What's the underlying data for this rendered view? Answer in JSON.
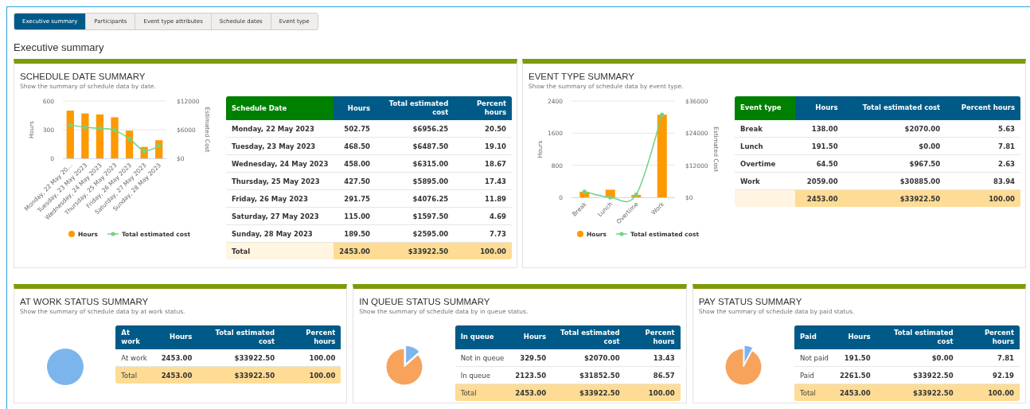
{
  "tabs": [
    {
      "label": "Executive summary",
      "selected": true
    },
    {
      "label": "Participants",
      "selected": false
    },
    {
      "label": "Event type attributes",
      "selected": false
    },
    {
      "label": "Schedule dates",
      "selected": false
    },
    {
      "label": "Event type",
      "selected": false
    }
  ],
  "page_title": "Executive summary",
  "panels": [
    {
      "kind": "combo",
      "title": "SCHEDULE DATE SUMMARY",
      "subtitle": "Show the summary of schedule data by date.",
      "chart_data": {
        "type": "bar",
        "ylabel": "Hours",
        "y2label": "Estimated Cost",
        "categories": [
          "Monday, 22 May 20…",
          "Tuesday, 23 May 2023",
          "Wednesday, 24 May 2023",
          "Thursday, 25 May 2023",
          "Friday, 26 May 2023",
          "Saturday, 27 May 2023",
          "Sunday, 28 May 2023"
        ],
        "series": [
          {
            "name": "Hours",
            "type": "bar",
            "color": "#ff9900",
            "values": [
              500,
              470,
              460,
              430,
              290,
              120,
              190
            ]
          },
          {
            "name": "Total estimated cost",
            "type": "line",
            "axis": "y2",
            "color": "#6fd483",
            "values": [
              7000,
              6500,
              6300,
              5900,
              4100,
              1600,
              2600
            ]
          }
        ],
        "legend": "bottom",
        "ylim": [
          0,
          600
        ],
        "y2lim": [
          0,
          12000
        ],
        "yticks": [
          0,
          300,
          600
        ],
        "y2ticks": [
          {
            "value": 0,
            "label": "$0"
          },
          {
            "value": 6000,
            "label": "$6000"
          },
          {
            "value": 12000,
            "label": "$12000"
          }
        ]
      },
      "table": {
        "columns": [
          "Schedule Date",
          "Hours",
          "Total estimated cost",
          "Percent hours"
        ],
        "rows": [
          [
            "Monday, 22 May 2023",
            "502.75",
            "$6956.25",
            "20.50"
          ],
          [
            "Tuesday, 23 May 2023",
            "468.50",
            "$6487.50",
            "19.10"
          ],
          [
            "Wednesday, 24 May 2023",
            "458.00",
            "$6315.00",
            "18.67"
          ],
          [
            "Thursday, 25 May 2023",
            "427.50",
            "$5895.00",
            "17.43"
          ],
          [
            "Friday, 26 May 2023",
            "291.75",
            "$4076.25",
            "11.89"
          ],
          [
            "Saturday, 27 May 2023",
            "115.00",
            "$1597.50",
            "4.69"
          ],
          [
            "Sunday, 28 May 2023",
            "189.50",
            "$2595.00",
            "7.73"
          ]
        ],
        "total": {
          "label": "Total",
          "values": [
            "2453.00",
            "$33922.50",
            "100.00"
          ]
        }
      }
    },
    {
      "kind": "combo",
      "title": "EVENT TYPE SUMMARY",
      "subtitle": "Show the summary of schedule data by event type.",
      "chart_data": {
        "type": "bar",
        "ylabel": "Hours",
        "y2label": "Estimated Cost",
        "categories": [
          "Break",
          "Lunch",
          "Overtime",
          "Work"
        ],
        "series": [
          {
            "name": "Hours",
            "type": "bar",
            "color": "#ff9900",
            "values": [
              140,
              190,
              60,
              2060
            ]
          },
          {
            "name": "Total estimated cost",
            "type": "line",
            "axis": "y2",
            "color": "#6fd483",
            "values": [
              2100,
              0,
              1000,
              30900
            ]
          }
        ],
        "legend": "bottom",
        "ylim": [
          0,
          2400
        ],
        "y2lim": [
          0,
          36000
        ],
        "yticks": [
          0,
          800,
          1600,
          2400
        ],
        "y2ticks": [
          {
            "value": 0,
            "label": "$0"
          },
          {
            "value": 12000,
            "label": "$12000"
          },
          {
            "value": 24000,
            "label": "$24000"
          },
          {
            "value": 36000,
            "label": "$36000"
          }
        ]
      },
      "table": {
        "columns": [
          "Event type",
          "Hours",
          "Total estimated cost",
          "Percent hours"
        ],
        "rows": [
          [
            "Break",
            "138.00",
            "$2070.00",
            "5.63"
          ],
          [
            "Lunch",
            "191.50",
            "$0.00",
            "7.81"
          ],
          [
            "Overtime",
            "64.50",
            "$967.50",
            "2.63"
          ],
          [
            "Work",
            "2059.00",
            "$30885.00",
            "83.94"
          ]
        ],
        "total": {
          "values": [
            "2453.00",
            "$33922.50",
            "100.00"
          ]
        }
      }
    },
    {
      "kind": "pie",
      "title": "AT WORK STATUS SUMMARY",
      "subtitle": "Show the summary of schedule data by at work status.",
      "chart_data": {
        "type": "pie",
        "values": [
          100
        ],
        "colors": [
          "#7cb5ec"
        ]
      },
      "table": {
        "columns": [
          "At work",
          "Hours",
          "Total estimated cost",
          "Percent hours"
        ],
        "rows": [
          [
            "At work",
            "2453.00",
            "$33922.50",
            "100.00"
          ]
        ],
        "total": {
          "label": "Total",
          "values": [
            "2453.00",
            "$33922.50",
            "100.00"
          ]
        }
      }
    },
    {
      "kind": "pie",
      "title": "IN QUEUE STATUS SUMMARY",
      "subtitle": "Show the summary of schedule data by in queue status.",
      "chart_data": {
        "type": "pie",
        "values": [
          13.43,
          86.57
        ],
        "colors": [
          "#7cb5ec",
          "#f7a35c"
        ]
      },
      "table": {
        "columns": [
          "In queue",
          "Hours",
          "Total estimated cost",
          "Percent hours"
        ],
        "rows": [
          [
            "Not in queue",
            "329.50",
            "$2070.00",
            "13.43"
          ],
          [
            "In queue",
            "2123.50",
            "$31852.50",
            "86.57"
          ]
        ],
        "total": {
          "label": "Total",
          "values": [
            "2453.00",
            "$33922.50",
            "100.00"
          ]
        }
      }
    },
    {
      "kind": "pie",
      "title": "PAY STATUS SUMMARY",
      "subtitle": "Show the summary of schedule data by paid status.",
      "chart_data": {
        "type": "pie",
        "values": [
          7.81,
          92.19
        ],
        "colors": [
          "#7cb5ec",
          "#f7a35c"
        ]
      },
      "table": {
        "columns": [
          "Paid",
          "Hours",
          "Total estimated cost",
          "Percent hours"
        ],
        "rows": [
          [
            "Not paid",
            "191.50",
            "$0.00",
            "7.81"
          ],
          [
            "Paid",
            "2261.50",
            "$33922.50",
            "92.19"
          ]
        ],
        "total": {
          "label": "Total",
          "values": [
            "2453.00",
            "$33922.50",
            "100.00"
          ]
        }
      }
    }
  ]
}
